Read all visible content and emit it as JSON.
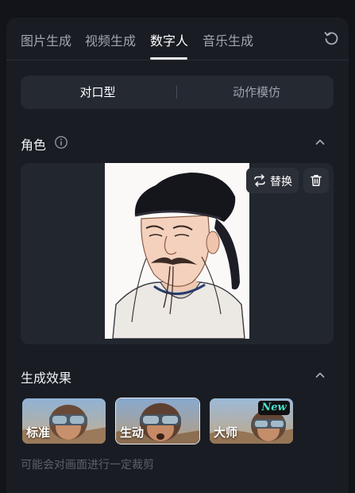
{
  "tabs": [
    {
      "label": "图片生成",
      "active": false
    },
    {
      "label": "视频生成",
      "active": false
    },
    {
      "label": "数字人",
      "active": true
    },
    {
      "label": "音乐生成",
      "active": false
    }
  ],
  "mode_switch": {
    "left": "对口型",
    "right": "动作模仿",
    "selected": "对口型"
  },
  "role_section": {
    "title": "角色",
    "replace_label": "替换",
    "icons": {
      "info": "info-icon",
      "collapse": "chevron-up-icon",
      "replace": "swap-icon",
      "delete": "trash-icon"
    }
  },
  "effect_section": {
    "title": "生成效果",
    "options": [
      {
        "label": "标准",
        "selected": false,
        "badge": ""
      },
      {
        "label": "生动",
        "selected": true,
        "badge": ""
      },
      {
        "label": "大师",
        "selected": false,
        "badge": "New"
      }
    ],
    "note": "可能会对画面进行一定裁剪"
  },
  "colors": {
    "accent_badge": "#4be0d0",
    "panel": "#191c23",
    "card": "#22262e"
  }
}
